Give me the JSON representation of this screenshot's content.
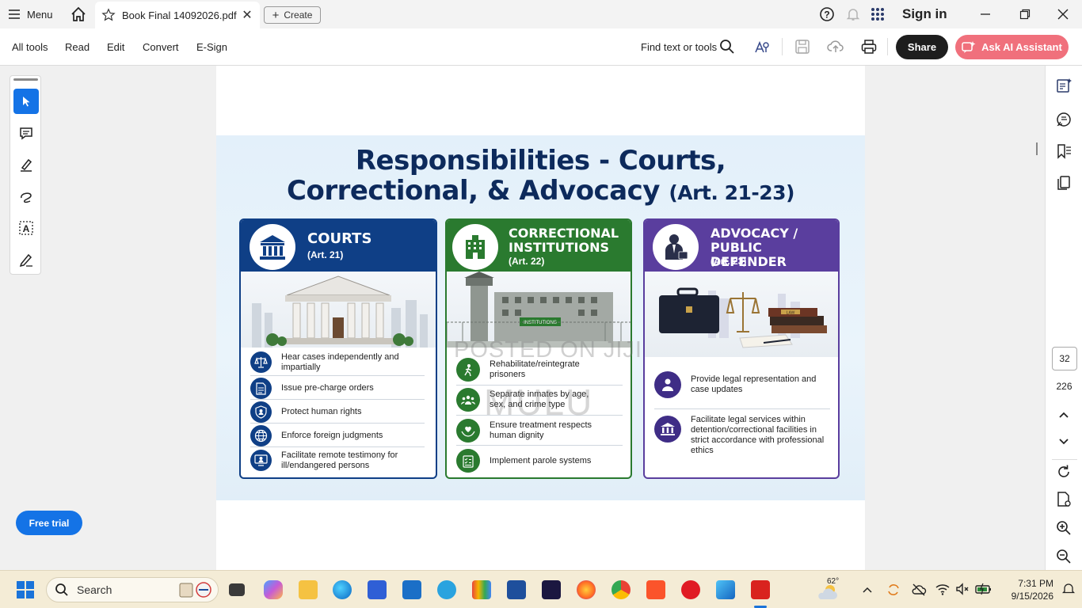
{
  "tabbar": {
    "menu_label": "Menu",
    "doc_tab_title": "Book Final 14092026.pdf",
    "close_glyph": "✕",
    "create_label": "Create",
    "sign_in_label": "Sign in"
  },
  "toolbar": {
    "menu": [
      "All tools",
      "Read",
      "Edit",
      "Convert",
      "E-Sign"
    ],
    "find_label": "Find text or tools",
    "share_label": "Share",
    "ai_label": "Ask AI Assistant"
  },
  "left_tools": {
    "free_trial_label": "Free trial"
  },
  "slide": {
    "title_line1": "Responsibilities - Courts,",
    "title_line2": "Correctional, & Advocacy",
    "title_art": "(Art. 21-23)",
    "watermark_1": "POSTED ON JIJI",
    "watermark_2": "MULU",
    "cards": [
      {
        "title_1": "COURTS",
        "title_2": "",
        "art": "(Art. 21)",
        "color": "#0f3f86",
        "items": [
          "Hear cases independently and impartially",
          "Issue pre-charge orders",
          "Protect human rights",
          "Enforce foreign judgments",
          "Facilitate remote testimony for ill/endangered persons"
        ]
      },
      {
        "title_1": "CORRECTIONAL",
        "title_2": "INSTITUTIONS",
        "art": "(Art. 22)",
        "color": "#2a7a2f",
        "sign": "INSTITUTIONS",
        "items": [
          "Rehabilitate/reintegrate prisoners",
          "Separate inmates by age, sex, and crime type",
          "Ensure treatment respects human dignity",
          "Implement parole systems"
        ]
      },
      {
        "title_1": "ADVOCACY /",
        "title_2": "PUBLIC DEFENDER",
        "art": "(Art. 23)",
        "color": "#5a3e9e",
        "book_label": "LAW",
        "items": [
          "Provide legal representation and case updates",
          "Facilitate legal services within detention/correctional facilities in strict accordance with professional ethics"
        ]
      }
    ]
  },
  "right_rail": {
    "current_page": "32",
    "total_pages": "226"
  },
  "taskbar": {
    "search_placeholder": "Search",
    "temperature": "62°",
    "time": "7:31 PM",
    "date": "9/15/2026"
  }
}
